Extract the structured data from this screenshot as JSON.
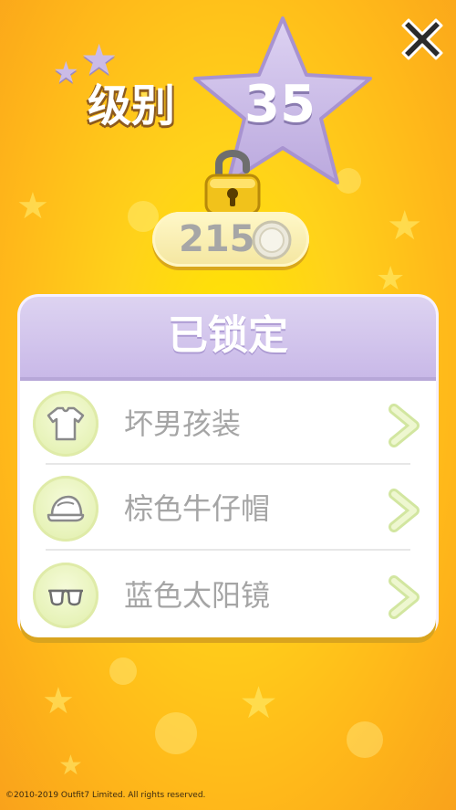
{
  "header": {
    "level_label": "级别",
    "level_number": "35"
  },
  "price": {
    "amount": "215",
    "currency_icon": "coin-icon"
  },
  "panel": {
    "title": "已锁定",
    "items": [
      {
        "label": "坏男孩装",
        "icon": "tshirt-icon"
      },
      {
        "label": "棕色牛仔帽",
        "icon": "cap-icon"
      },
      {
        "label": "蓝色太阳镜",
        "icon": "glasses-icon"
      }
    ]
  },
  "footer": {
    "copyright": "©2010-2019 Outfit7 Limited. All rights reserved."
  },
  "colors": {
    "background": "#ffd21a",
    "panel_header": "#c9b9e8",
    "star": "#c8b8e4",
    "arrow": "#e4f2b4"
  }
}
